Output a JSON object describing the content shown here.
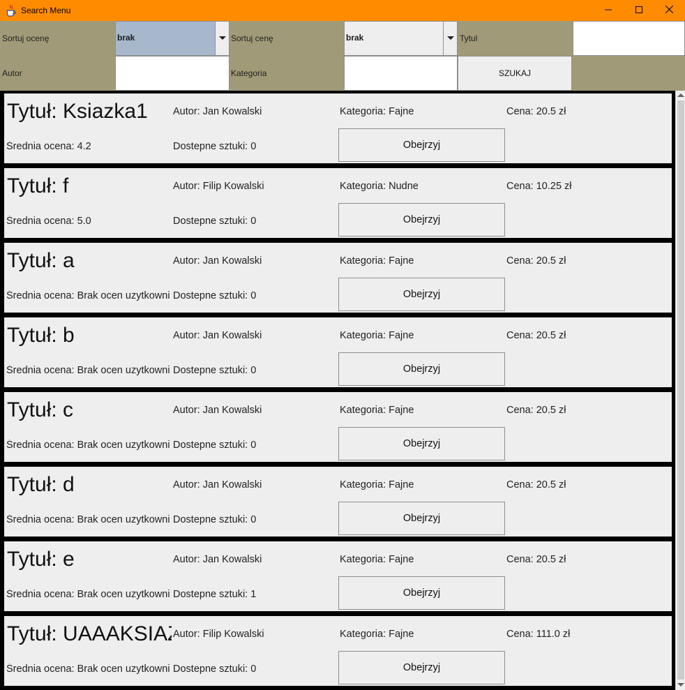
{
  "window": {
    "title": "Search Menu",
    "icon": "java-cup-icon",
    "controls": [
      "minimize-icon",
      "maximize-icon",
      "close-icon"
    ]
  },
  "filters": {
    "sort_rating_label": "Sortuj ocenę",
    "sort_rating_value": "brak",
    "sort_price_label": "Sortuj cenę",
    "sort_price_value": "brak",
    "title_label": "Tytul",
    "title_value": "",
    "author_label": "Autor",
    "author_value": "",
    "category_label": "Kategoria",
    "category_value": "",
    "search_button": "SZUKAJ"
  },
  "books": [
    {
      "title": "Tytuł: Ksiazka1",
      "author": "Autor: Jan Kowalski",
      "category": "Kategoria: Fajne",
      "price": "Cena: 20.5 zł",
      "rating": "Średnia ocena: 4.2",
      "stock": "Dostepne sztuki: 0",
      "button": "Obejrzyj"
    },
    {
      "title": "Tytuł: f",
      "author": "Autor: Filip Kowalski",
      "category": "Kategoria: Nudne",
      "price": "Cena: 10.25 zł",
      "rating": "Średnia ocena: 5.0",
      "stock": "Dostepne sztuki: 0",
      "button": "Obejrzyj"
    },
    {
      "title": "Tytuł: a",
      "author": "Autor: Jan Kowalski",
      "category": "Kategoria: Fajne",
      "price": "Cena: 20.5 zł",
      "rating": "Średnia ocena: Brak ocen uzytkowni",
      "stock": "Dostepne sztuki: 0",
      "button": "Obejrzyj"
    },
    {
      "title": "Tytuł: b",
      "author": "Autor: Jan Kowalski",
      "category": "Kategoria: Fajne",
      "price": "Cena: 20.5 zł",
      "rating": "Średnia ocena: Brak ocen uzytkowni",
      "stock": "Dostepne sztuki: 0",
      "button": "Obejrzyj"
    },
    {
      "title": "Tytuł: c",
      "author": "Autor: Jan Kowalski",
      "category": "Kategoria: Fajne",
      "price": "Cena: 20.5 zł",
      "rating": "Średnia ocena: Brak ocen uzytkowni",
      "stock": "Dostepne sztuki: 0",
      "button": "Obejrzyj"
    },
    {
      "title": "Tytuł: d",
      "author": "Autor: Jan Kowalski",
      "category": "Kategoria: Fajne",
      "price": "Cena: 20.5 zł",
      "rating": "Średnia ocena: Brak ocen uzytkowni",
      "stock": "Dostepne sztuki: 0",
      "button": "Obejrzyj"
    },
    {
      "title": "Tytuł: e",
      "author": "Autor: Jan Kowalski",
      "category": "Kategoria: Fajne",
      "price": "Cena: 20.5 zł",
      "rating": "Średnia ocena: Brak ocen uzytkowni",
      "stock": "Dostepne sztuki: 1",
      "button": "Obejrzyj"
    },
    {
      "title": "Tytuł: UAAAKSIAZ",
      "author": "Autor: Filip Kowalski",
      "category": "Kategoria: Fajne",
      "price": "Cena: 111.0 zł",
      "rating": "Średnia ocena: Brak ocen uzytkowni",
      "stock": "Dostepne sztuki: 0",
      "button": "Obejrzyj"
    }
  ]
}
